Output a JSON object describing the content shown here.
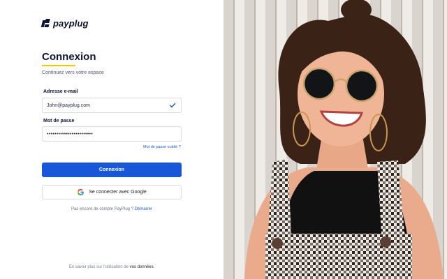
{
  "brand": {
    "name": "payplug"
  },
  "login": {
    "title": "Connexion",
    "subtitle": "Continuez vers votre espace",
    "email_label": "Adresse e-mail",
    "email_value": "John@payplug.com",
    "password_label": "Mot de passe",
    "password_value": "••••••••••••••••••••••••",
    "forgot_link": "Mot de passe oublié ?",
    "submit_label": "Connexion",
    "google_label": "Se connecter avec Google",
    "signup_text": "Pas encore de compte PayPlug ?",
    "signup_link": "Démarrer"
  },
  "footer": {
    "text": "En savoir plus sur l'utilisation de",
    "link": "vos données."
  },
  "colors": {
    "primary": "#1757d8",
    "accent": "#f6c400",
    "brand_dark": "#0d1436"
  },
  "icons": {
    "check": "check-icon",
    "google": "google-icon"
  }
}
